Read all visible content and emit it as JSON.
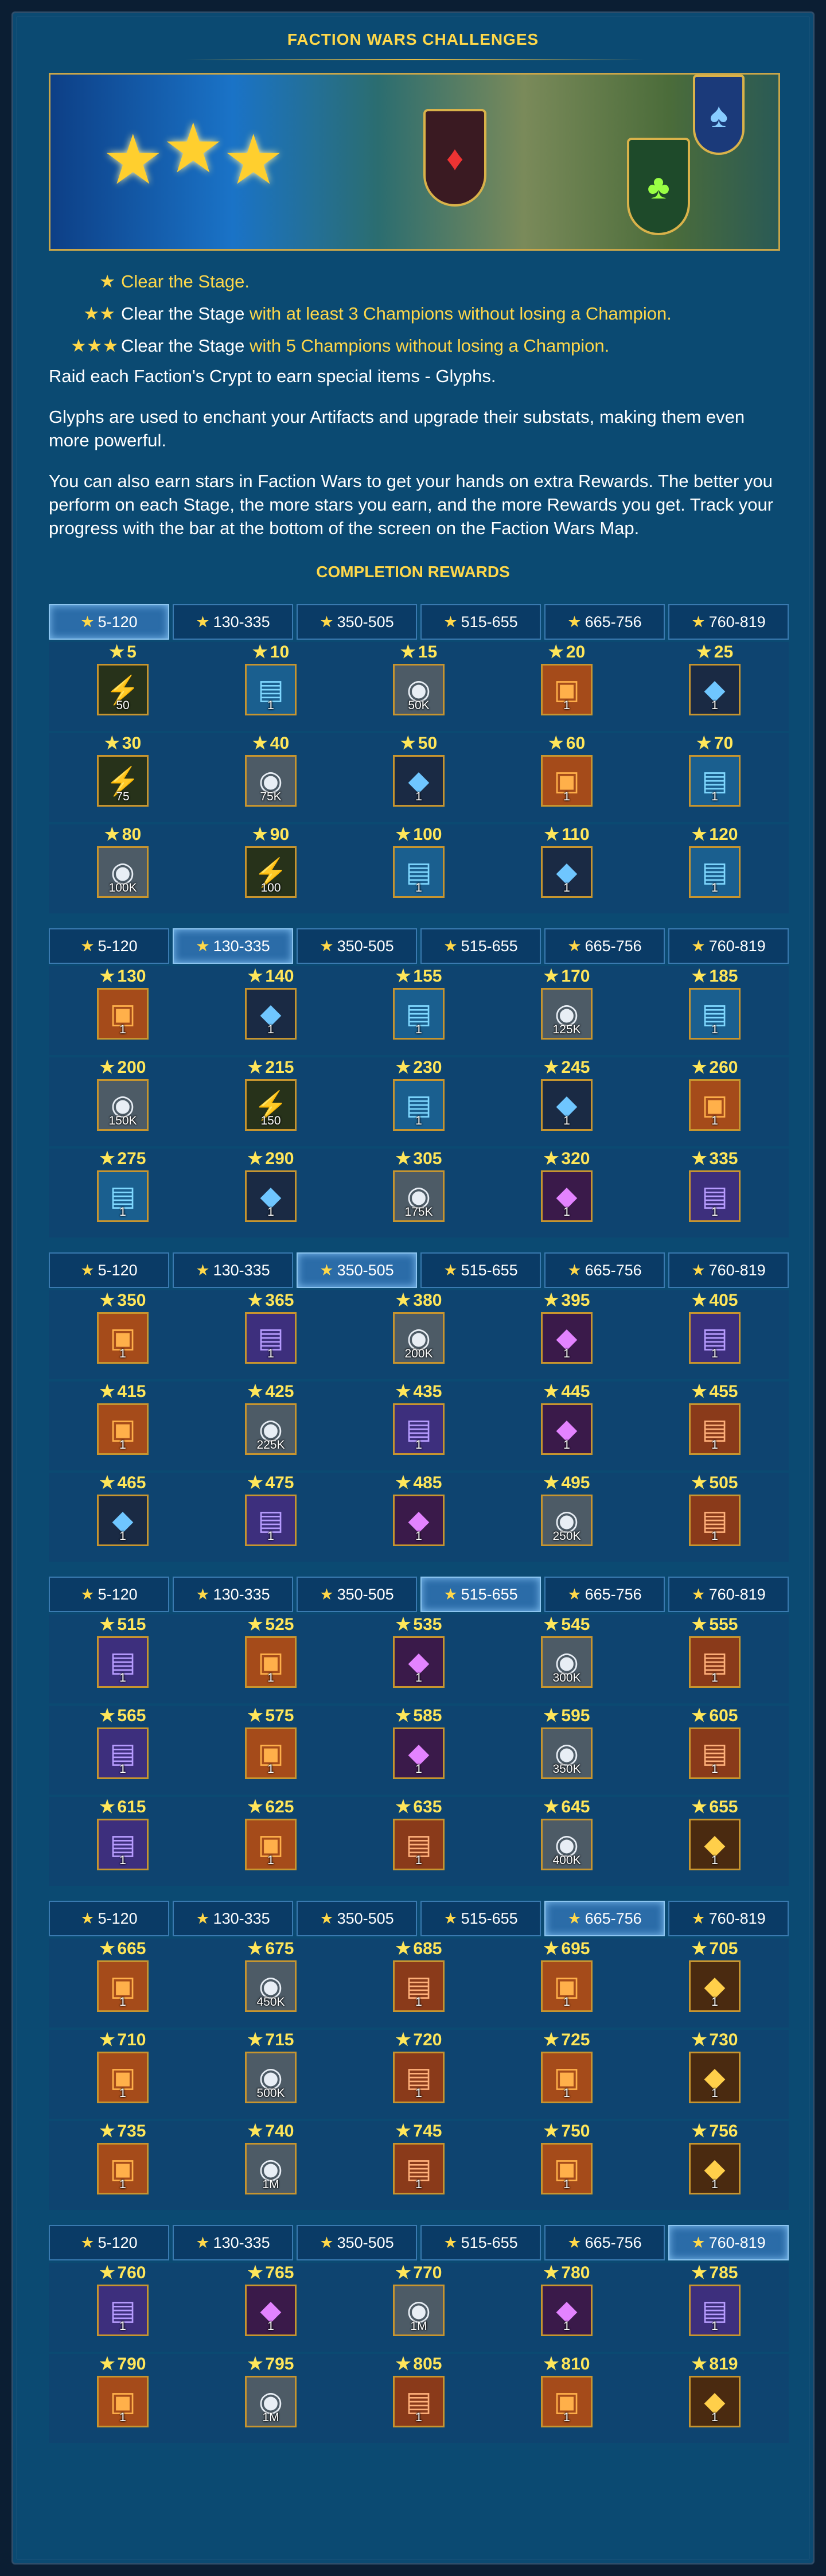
{
  "title": "FACTION WARS CHALLENGES",
  "rules": [
    {
      "stars": "★",
      "parts": [
        {
          "text": "Clear the Stage.",
          "yellow": true
        }
      ]
    },
    {
      "stars": "★★",
      "parts": [
        {
          "text": "Clear the Stage ",
          "yellow": false
        },
        {
          "text": "with at least 3 Champions without losing a Champion.",
          "yellow": true
        }
      ]
    },
    {
      "stars": "★★★",
      "parts": [
        {
          "text": "Clear the Stage ",
          "yellow": false
        },
        {
          "text": "with 5 Champions without losing a Champion.",
          "yellow": true
        }
      ]
    }
  ],
  "para1": "Raid each Faction's Crypt to earn special items - Glyphs.",
  "para2": "Glyphs are used to enchant your Artifacts and upgrade their substats, making them even more powerful.",
  "para3": "You can also earn stars in Faction Wars to get your hands on extra Rewards. The better you perform on each Stage, the more stars you earn, and the more Rewards you get. Track your progress with the bar at the bottom of the screen on the Faction Wars Map.",
  "subtitle": "COMPLETION REWARDS",
  "tab_labels": [
    "5-120",
    "130-335",
    "350-505",
    "515-655",
    "665-756",
    "760-819"
  ],
  "icons": {
    "energy": "energy-icon",
    "book": "glyph-book-icon",
    "silver": "silver-coin-icon",
    "shard-blue": "ancient-shard-icon",
    "shard-purple": "void-shard-icon",
    "chest": "chest-icon",
    "book-purple": "rare-glyph-book-icon",
    "book-orange": "epic-glyph-book-icon",
    "shard-gold": "sacred-shard-icon"
  },
  "sections": [
    {
      "active": 0,
      "rows": [
        [
          {
            "s": "5",
            "i": "energy",
            "q": "50"
          },
          {
            "s": "10",
            "i": "book",
            "q": "1"
          },
          {
            "s": "15",
            "i": "silver",
            "q": "50K"
          },
          {
            "s": "20",
            "i": "chest",
            "q": "1"
          },
          {
            "s": "25",
            "i": "shard-blue",
            "q": "1"
          }
        ],
        [
          {
            "s": "30",
            "i": "energy",
            "q": "75"
          },
          {
            "s": "40",
            "i": "silver",
            "q": "75K"
          },
          {
            "s": "50",
            "i": "shard-blue",
            "q": "1"
          },
          {
            "s": "60",
            "i": "chest",
            "q": "1"
          },
          {
            "s": "70",
            "i": "book",
            "q": "1"
          }
        ],
        [
          {
            "s": "80",
            "i": "silver",
            "q": "100K"
          },
          {
            "s": "90",
            "i": "energy",
            "q": "100"
          },
          {
            "s": "100",
            "i": "book",
            "q": "1"
          },
          {
            "s": "110",
            "i": "shard-blue",
            "q": "1"
          },
          {
            "s": "120",
            "i": "book",
            "q": "1"
          }
        ]
      ]
    },
    {
      "active": 1,
      "rows": [
        [
          {
            "s": "130",
            "i": "chest",
            "q": "1"
          },
          {
            "s": "140",
            "i": "shard-blue",
            "q": "1"
          },
          {
            "s": "155",
            "i": "book",
            "q": "1"
          },
          {
            "s": "170",
            "i": "silver",
            "q": "125K"
          },
          {
            "s": "185",
            "i": "book",
            "q": "1"
          }
        ],
        [
          {
            "s": "200",
            "i": "silver",
            "q": "150K"
          },
          {
            "s": "215",
            "i": "energy",
            "q": "150"
          },
          {
            "s": "230",
            "i": "book",
            "q": "1"
          },
          {
            "s": "245",
            "i": "shard-blue",
            "q": "1"
          },
          {
            "s": "260",
            "i": "chest",
            "q": "1"
          }
        ],
        [
          {
            "s": "275",
            "i": "book",
            "q": "1"
          },
          {
            "s": "290",
            "i": "shard-blue",
            "q": "1"
          },
          {
            "s": "305",
            "i": "silver",
            "q": "175K"
          },
          {
            "s": "320",
            "i": "shard-purple",
            "q": "1"
          },
          {
            "s": "335",
            "i": "book-purple",
            "q": "1"
          }
        ]
      ]
    },
    {
      "active": 2,
      "rows": [
        [
          {
            "s": "350",
            "i": "chest",
            "q": "1"
          },
          {
            "s": "365",
            "i": "book-purple",
            "q": "1"
          },
          {
            "s": "380",
            "i": "silver",
            "q": "200K"
          },
          {
            "s": "395",
            "i": "shard-purple",
            "q": "1"
          },
          {
            "s": "405",
            "i": "book-purple",
            "q": "1"
          }
        ],
        [
          {
            "s": "415",
            "i": "chest",
            "q": "1"
          },
          {
            "s": "425",
            "i": "silver",
            "q": "225K"
          },
          {
            "s": "435",
            "i": "book-purple",
            "q": "1"
          },
          {
            "s": "445",
            "i": "shard-purple",
            "q": "1"
          },
          {
            "s": "455",
            "i": "book-orange",
            "q": "1"
          }
        ],
        [
          {
            "s": "465",
            "i": "shard-blue",
            "q": "1"
          },
          {
            "s": "475",
            "i": "book-purple",
            "q": "1"
          },
          {
            "s": "485",
            "i": "shard-purple",
            "q": "1"
          },
          {
            "s": "495",
            "i": "silver",
            "q": "250K"
          },
          {
            "s": "505",
            "i": "book-orange",
            "q": "1"
          }
        ]
      ]
    },
    {
      "active": 3,
      "rows": [
        [
          {
            "s": "515",
            "i": "book-purple",
            "q": "1"
          },
          {
            "s": "525",
            "i": "chest",
            "q": "1"
          },
          {
            "s": "535",
            "i": "shard-purple",
            "q": "1"
          },
          {
            "s": "545",
            "i": "silver",
            "q": "300K"
          },
          {
            "s": "555",
            "i": "book-orange",
            "q": "1"
          }
        ],
        [
          {
            "s": "565",
            "i": "book-purple",
            "q": "1"
          },
          {
            "s": "575",
            "i": "chest",
            "q": "1"
          },
          {
            "s": "585",
            "i": "shard-purple",
            "q": "1"
          },
          {
            "s": "595",
            "i": "silver",
            "q": "350K"
          },
          {
            "s": "605",
            "i": "book-orange",
            "q": "1"
          }
        ],
        [
          {
            "s": "615",
            "i": "book-purple",
            "q": "1"
          },
          {
            "s": "625",
            "i": "chest",
            "q": "1"
          },
          {
            "s": "635",
            "i": "book-orange",
            "q": "1"
          },
          {
            "s": "645",
            "i": "silver",
            "q": "400K"
          },
          {
            "s": "655",
            "i": "shard-gold",
            "q": "1"
          }
        ]
      ]
    },
    {
      "active": 4,
      "rows": [
        [
          {
            "s": "665",
            "i": "chest",
            "q": "1"
          },
          {
            "s": "675",
            "i": "silver",
            "q": "450K"
          },
          {
            "s": "685",
            "i": "book-orange",
            "q": "1"
          },
          {
            "s": "695",
            "i": "chest",
            "q": "1"
          },
          {
            "s": "705",
            "i": "shard-gold",
            "q": "1"
          }
        ],
        [
          {
            "s": "710",
            "i": "chest",
            "q": "1"
          },
          {
            "s": "715",
            "i": "silver",
            "q": "500K"
          },
          {
            "s": "720",
            "i": "book-orange",
            "q": "1"
          },
          {
            "s": "725",
            "i": "chest",
            "q": "1"
          },
          {
            "s": "730",
            "i": "shard-gold",
            "q": "1"
          }
        ],
        [
          {
            "s": "735",
            "i": "chest",
            "q": "1"
          },
          {
            "s": "740",
            "i": "silver",
            "q": "1M"
          },
          {
            "s": "745",
            "i": "book-orange",
            "q": "1"
          },
          {
            "s": "750",
            "i": "chest",
            "q": "1"
          },
          {
            "s": "756",
            "i": "shard-gold",
            "q": "1"
          }
        ]
      ]
    },
    {
      "active": 5,
      "rows": [
        [
          {
            "s": "760",
            "i": "book-purple",
            "q": "1"
          },
          {
            "s": "765",
            "i": "shard-purple",
            "q": "1"
          },
          {
            "s": "770",
            "i": "silver",
            "q": "1M"
          },
          {
            "s": "780",
            "i": "shard-purple",
            "q": "1"
          },
          {
            "s": "785",
            "i": "book-purple",
            "q": "1"
          }
        ],
        [
          {
            "s": "790",
            "i": "chest",
            "q": "1"
          },
          {
            "s": "795",
            "i": "silver",
            "q": "1M"
          },
          {
            "s": "805",
            "i": "book-orange",
            "q": "1"
          },
          {
            "s": "810",
            "i": "chest",
            "q": "1"
          },
          {
            "s": "819",
            "i": "shard-gold",
            "q": "1"
          }
        ]
      ]
    }
  ],
  "colors": {
    "accent": "#ffd84a",
    "panel": "#0b4a72",
    "frame": "#c7952f"
  }
}
